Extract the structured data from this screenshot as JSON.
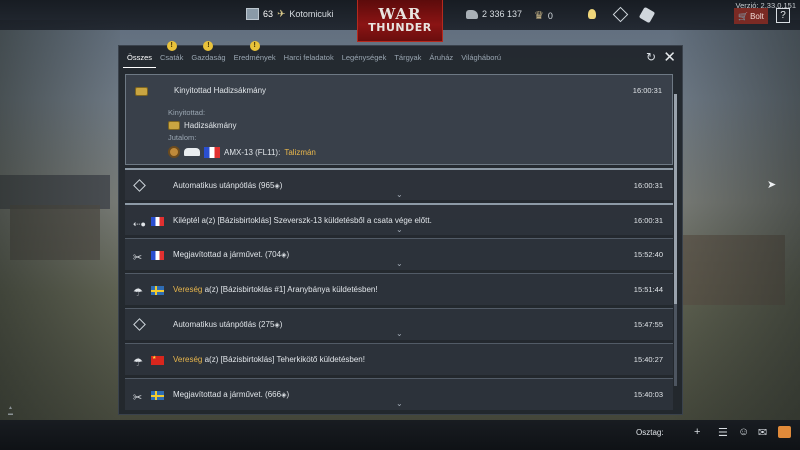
{
  "app": {
    "version": "Verzió: 2.33.0.151",
    "logo_top": "WAR",
    "logo_bottom": "THUNDER"
  },
  "player": {
    "level": "63",
    "name": "Kotomicuki"
  },
  "currency": {
    "silver_lions": "2 336 137",
    "golden_eagles": "0"
  },
  "top_buttons": {
    "shop_label": "Bolt",
    "help_label": "?"
  },
  "tabs": [
    {
      "label": "Összes",
      "warn": false,
      "active": true
    },
    {
      "label": "Csaták",
      "warn": true,
      "active": false
    },
    {
      "label": "Gazdaság",
      "warn": true,
      "active": false
    },
    {
      "label": "Eredmények",
      "warn": true,
      "active": false
    },
    {
      "label": "Harci feladatok",
      "warn": false,
      "active": false
    },
    {
      "label": "Legénységek",
      "warn": false,
      "active": false
    },
    {
      "label": "Tárgyak",
      "warn": false,
      "active": false
    },
    {
      "label": "Áruház",
      "warn": false,
      "active": false
    },
    {
      "label": "Világháború",
      "warn": false,
      "active": false
    }
  ],
  "warn_badge": "!",
  "expanded_entry": {
    "title": "Kinyitottad Hadizsákmány",
    "time": "16:00:31",
    "opened_label": "Kinyitottad:",
    "item_name": "Hadizsákmány",
    "reward_label": "Jutalom:",
    "vehicle": "AMX-13 (FL11):",
    "reward_name": "Talizmán"
  },
  "entries": [
    {
      "icon": "repair-cost-icon",
      "flag": "",
      "text_prefix": "",
      "text": "Automatikus utánpótlás (965",
      "suffix": ")",
      "time": "16:00:31",
      "chevron": true,
      "sep": true
    },
    {
      "icon": "exit-battle-icon",
      "flag": "fr",
      "text_prefix": "",
      "text": "Kiléptél a(z) [Bázisbirtoklás] Szeverszk-13 küldetésből a csata vége előtt.",
      "suffix": "",
      "time": "16:00:31",
      "chevron": true,
      "sep": true
    },
    {
      "icon": "wrench-icon",
      "flag": "fr",
      "text_prefix": "",
      "text": "Megjavítottad a járművet. (704",
      "suffix": ")",
      "time": "15:52:40",
      "chevron": true,
      "sep": false
    },
    {
      "icon": "parachute-icon",
      "flag": "se",
      "text_prefix": "Vereség",
      "text": " a(z) [Bázisbirtoklás #1] Aranybánya küldetésben!",
      "suffix": "",
      "time": "15:51:44",
      "chevron": false,
      "sep": false
    },
    {
      "icon": "repair-cost-icon",
      "flag": "",
      "text_prefix": "",
      "text": "Automatikus utánpótlás (275",
      "suffix": ")",
      "time": "15:47:55",
      "chevron": true,
      "sep": false
    },
    {
      "icon": "parachute-icon",
      "flag": "cn",
      "text_prefix": "Vereség",
      "text": " a(z) [Bázisbirtoklás] Teherkikötő küldetésben!",
      "suffix": "",
      "time": "15:40:27",
      "chevron": false,
      "sep": false
    },
    {
      "icon": "wrench-icon",
      "flag": "se",
      "text_prefix": "",
      "text": "Megjavítottad a járművet. (666",
      "suffix": ")",
      "time": "15:40:03",
      "chevron": true,
      "sep": false
    }
  ],
  "bottom": {
    "squad_label": "Osztag:",
    "add_label": "+"
  },
  "colors": {
    "accent_gold": "#e8b64c",
    "shop_red": "#7a2a24",
    "panel_bg": "#21262d"
  }
}
